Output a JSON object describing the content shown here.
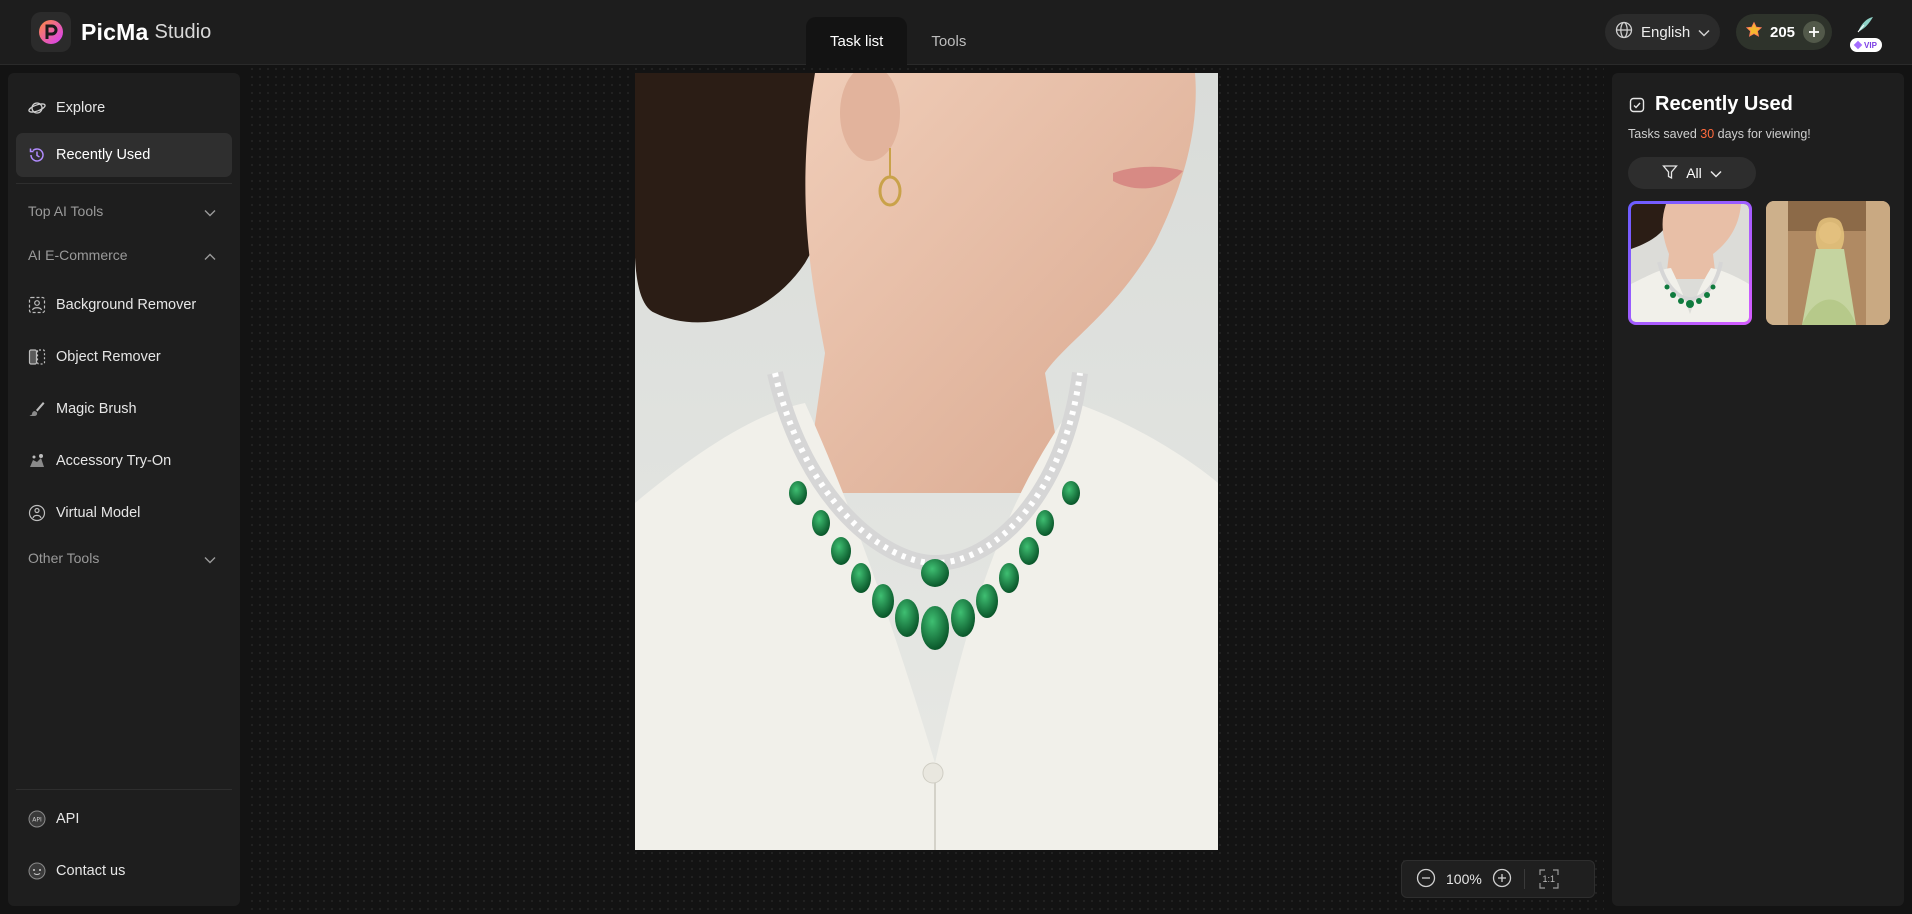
{
  "app": {
    "brand": "PicMa",
    "product": "Studio"
  },
  "header": {
    "tabs": [
      {
        "label": "Task list",
        "active": true
      },
      {
        "label": "Tools",
        "active": false
      }
    ],
    "language": "English",
    "credits": "205",
    "vip_badge": "VIP"
  },
  "sidebar": {
    "top_items": [
      {
        "label": "Explore",
        "icon": "planet-icon"
      },
      {
        "label": "Recently Used",
        "icon": "history-icon",
        "active": true
      }
    ],
    "sections": {
      "top_ai_tools": "Top AI Tools",
      "ai_ecommerce": "AI E-Commerce",
      "other_tools": "Other Tools"
    },
    "ecommerce_items": [
      {
        "label": "Background Remover",
        "icon": "background-remover-icon"
      },
      {
        "label": "Object Remover",
        "icon": "object-remover-icon"
      },
      {
        "label": "Magic Brush",
        "icon": "brush-icon"
      },
      {
        "label": "Accessory Try-On",
        "icon": "accessory-icon"
      },
      {
        "label": "Virtual Model",
        "icon": "virtual-model-icon"
      }
    ],
    "bottom_items": [
      {
        "label": "API",
        "icon": "api-icon"
      },
      {
        "label": "Contact us",
        "icon": "chat-icon"
      }
    ]
  },
  "canvas": {
    "zoom": "100%",
    "actual_size_label": "1:1"
  },
  "recent_panel": {
    "title": "Recently Used",
    "note_prefix": "Tasks saved ",
    "note_days": "30",
    "note_suffix": " days for viewing!",
    "filter": "All"
  },
  "colors": {
    "accent": "#8a5cff",
    "highlight": "#ff6a3d",
    "emerald": "#0f7a3d"
  }
}
